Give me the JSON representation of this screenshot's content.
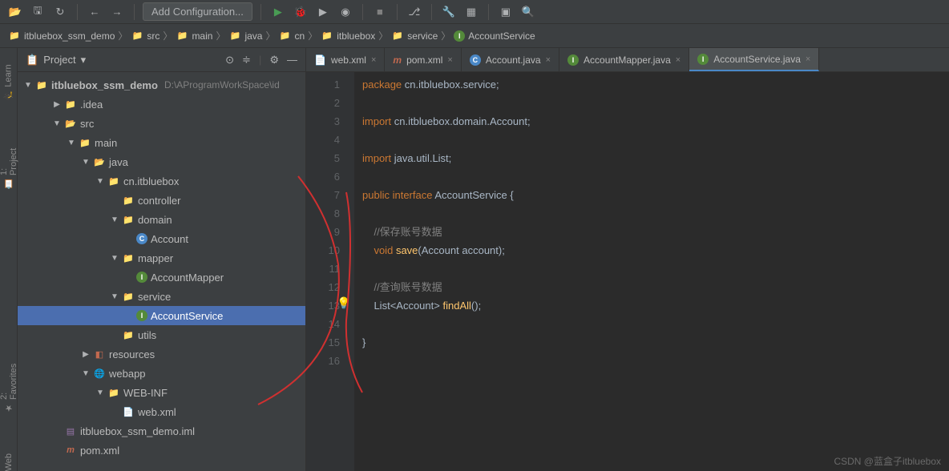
{
  "toolbar": {
    "config_label": "Add Configuration..."
  },
  "breadcrumb": {
    "items": [
      "itbluebox_ssm_demo",
      "src",
      "main",
      "java",
      "cn",
      "itbluebox",
      "service",
      "AccountService"
    ]
  },
  "left_rail": {
    "items": [
      "Learn",
      "1: Project",
      "2: Favorites",
      "Web"
    ]
  },
  "project_panel": {
    "title": "Project",
    "root": "itbluebox_ssm_demo",
    "root_path": "D:\\AProgramWorkSpace\\id",
    "tree": [
      {
        "label": ".idea",
        "indent": 2,
        "arrow": "▶",
        "icon": "folder"
      },
      {
        "label": "src",
        "indent": 2,
        "arrow": "▼",
        "icon": "folder-open"
      },
      {
        "label": "main",
        "indent": 3,
        "arrow": "▼",
        "icon": "folder"
      },
      {
        "label": "java",
        "indent": 4,
        "arrow": "▼",
        "icon": "folder-open"
      },
      {
        "label": "cn.itbluebox",
        "indent": 5,
        "arrow": "▼",
        "icon": "folder"
      },
      {
        "label": "controller",
        "indent": 6,
        "arrow": "",
        "icon": "folder"
      },
      {
        "label": "domain",
        "indent": 6,
        "arrow": "▼",
        "icon": "folder"
      },
      {
        "label": "Account",
        "indent": 7,
        "arrow": "",
        "icon": "class"
      },
      {
        "label": "mapper",
        "indent": 6,
        "arrow": "▼",
        "icon": "folder"
      },
      {
        "label": "AccountMapper",
        "indent": 7,
        "arrow": "",
        "icon": "interface"
      },
      {
        "label": "service",
        "indent": 6,
        "arrow": "▼",
        "icon": "folder"
      },
      {
        "label": "AccountService",
        "indent": 7,
        "arrow": "",
        "icon": "interface",
        "selected": true
      },
      {
        "label": "utils",
        "indent": 6,
        "arrow": "",
        "icon": "folder"
      },
      {
        "label": "resources",
        "indent": 4,
        "arrow": "▶",
        "icon": "resources"
      },
      {
        "label": "webapp",
        "indent": 4,
        "arrow": "▼",
        "icon": "webapp"
      },
      {
        "label": "WEB-INF",
        "indent": 5,
        "arrow": "▼",
        "icon": "folder"
      },
      {
        "label": "web.xml",
        "indent": 6,
        "arrow": "",
        "icon": "xml"
      },
      {
        "label": "itbluebox_ssm_demo.iml",
        "indent": 2,
        "arrow": "",
        "icon": "iml"
      },
      {
        "label": "pom.xml",
        "indent": 2,
        "arrow": "",
        "icon": "maven"
      }
    ]
  },
  "tabs": [
    {
      "label": "web.xml",
      "icon": "xml"
    },
    {
      "label": "pom.xml",
      "icon": "maven"
    },
    {
      "label": "Account.java",
      "icon": "class"
    },
    {
      "label": "AccountMapper.java",
      "icon": "interface"
    },
    {
      "label": "AccountService.java",
      "icon": "interface",
      "active": true
    }
  ],
  "code": {
    "lines": [
      {
        "n": 1,
        "html": "<span class='kw'>package</span> <span class='pkg'>cn.itbluebox.service</span><span class='punct'>;</span>"
      },
      {
        "n": 2,
        "html": ""
      },
      {
        "n": 3,
        "html": "<span class='kw'>import</span> <span class='pkg'>cn.itbluebox.domain.Account</span><span class='punct'>;</span>"
      },
      {
        "n": 4,
        "html": ""
      },
      {
        "n": 5,
        "html": "<span class='kw'>import</span> <span class='pkg'>java.util.List</span><span class='punct'>;</span>"
      },
      {
        "n": 6,
        "html": ""
      },
      {
        "n": 7,
        "html": "<span class='kw'>public</span> <span class='kw'>interface</span> <span class='cls'>AccountService</span> <span class='punct'>{</span>"
      },
      {
        "n": 8,
        "html": ""
      },
      {
        "n": 9,
        "html": "    <span class='comment'>//保存账号数据</span>"
      },
      {
        "n": 10,
        "html": "    <span class='kw'>void</span> <span class='method'>save</span><span class='punct'>(</span><span class='cls'>Account</span> <span class='type'>account</span><span class='punct'>);</span>"
      },
      {
        "n": 11,
        "html": ""
      },
      {
        "n": 12,
        "html": "    <span class='comment'>//查询账号数据</span>"
      },
      {
        "n": 13,
        "html": "    <span class='cls'>List</span><span class='punct'>&lt;</span><span class='cls'>Account</span><span class='punct'>&gt;</span> <span class='method'>findAll</span><span class='punct'>();</span>"
      },
      {
        "n": 14,
        "html": ""
      },
      {
        "n": 15,
        "html": "<span class='punct'>}</span>"
      },
      {
        "n": 16,
        "html": ""
      }
    ]
  },
  "watermark": "CSDN @蓝盒子itbluebox"
}
